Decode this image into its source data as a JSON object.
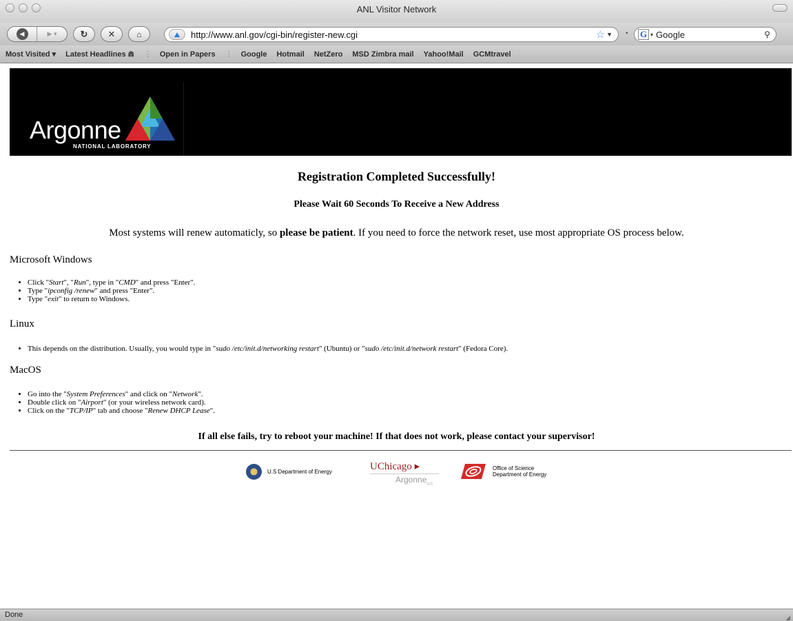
{
  "window": {
    "title": "ANL Visitor Network"
  },
  "toolbar": {
    "url": "http://www.anl.gov/cgi-bin/register-new.cgi",
    "search_value": "Google"
  },
  "bookmarks": [
    {
      "label": "Most Visited ▾"
    },
    {
      "label": "Latest Headlines ⋒"
    },
    {
      "label": "Open in Papers"
    },
    {
      "label": "Google"
    },
    {
      "label": "Hotmail"
    },
    {
      "label": "NetZero"
    },
    {
      "label": "MSD Zimbra mail"
    },
    {
      "label": "Yahoo!Mail"
    },
    {
      "label": "GCMtravel"
    }
  ],
  "banner": {
    "logo_word": "Argonne",
    "logo_sub": "NATIONAL LABORATORY"
  },
  "page": {
    "heading": "Registration Completed Successfully!",
    "subheading": "Please Wait 60 Seconds To Receive a New Address",
    "intro_before": "Most systems will renew automaticly, so ",
    "intro_bold": "please be patient",
    "intro_after": ". If you need to force the network reset, use most appropriate OS process below.",
    "sections": [
      {
        "title": "Microsoft Windows",
        "items": [
          [
            {
              "t": "Click \""
            },
            {
              "t": "Start",
              "i": true
            },
            {
              "t": "\", \""
            },
            {
              "t": "Run",
              "i": true
            },
            {
              "t": "\", type in \""
            },
            {
              "t": "CMD",
              "i": true
            },
            {
              "t": "\" and press \"Enter\"."
            }
          ],
          [
            {
              "t": "Type \""
            },
            {
              "t": "ipconfig  /renew",
              "i": true
            },
            {
              "t": "\" and press \"Enter\"."
            }
          ],
          [
            {
              "t": "Type \""
            },
            {
              "t": "exit",
              "i": true
            },
            {
              "t": "\" to return to Windows."
            }
          ]
        ]
      },
      {
        "title": "Linux",
        "items": [
          [
            {
              "t": "This depends on the distribution. Usually, you would type in \""
            },
            {
              "t": "sudo /etc/init.d/networking restart",
              "i": true
            },
            {
              "t": "\" (Ubuntu) or \""
            },
            {
              "t": "sudo /etc/init.d/network restart",
              "i": true
            },
            {
              "t": "\" (Fedora Core)."
            }
          ]
        ]
      },
      {
        "title": "MacOS",
        "items": [
          [
            {
              "t": "Go into the \""
            },
            {
              "t": "System Preferences",
              "i": true
            },
            {
              "t": "\" and click on \""
            },
            {
              "t": "Network",
              "i": true
            },
            {
              "t": "\"."
            }
          ],
          [
            {
              "t": "Double click on \""
            },
            {
              "t": "Airport",
              "i": true
            },
            {
              "t": "\" (or your wireless network card)."
            }
          ],
          [
            {
              "t": "Click on the \""
            },
            {
              "t": "TCP/IP",
              "i": true
            },
            {
              "t": "\" tab and choose \""
            },
            {
              "t": "Renew DHCP Lease",
              "i": true
            },
            {
              "t": "\"."
            }
          ]
        ]
      }
    ],
    "final_note": "If all else fails, try to reboot your machine! If that does not work, please contact your supervisor!"
  },
  "footer": {
    "doe": "U.S Department of Energy",
    "uchicago_top": "UChicago ▸",
    "uchicago_bottom": "Argonne",
    "uchicago_llc": "LLC",
    "office_line1": "Office of Science",
    "office_line2": "Department of Energy"
  },
  "status": {
    "text": "Done"
  },
  "colors": {
    "logo_green": "#7ab648",
    "logo_blue": "#1f6fb5",
    "logo_red": "#d7262e",
    "uchicago_red": "#9b1c1c"
  }
}
